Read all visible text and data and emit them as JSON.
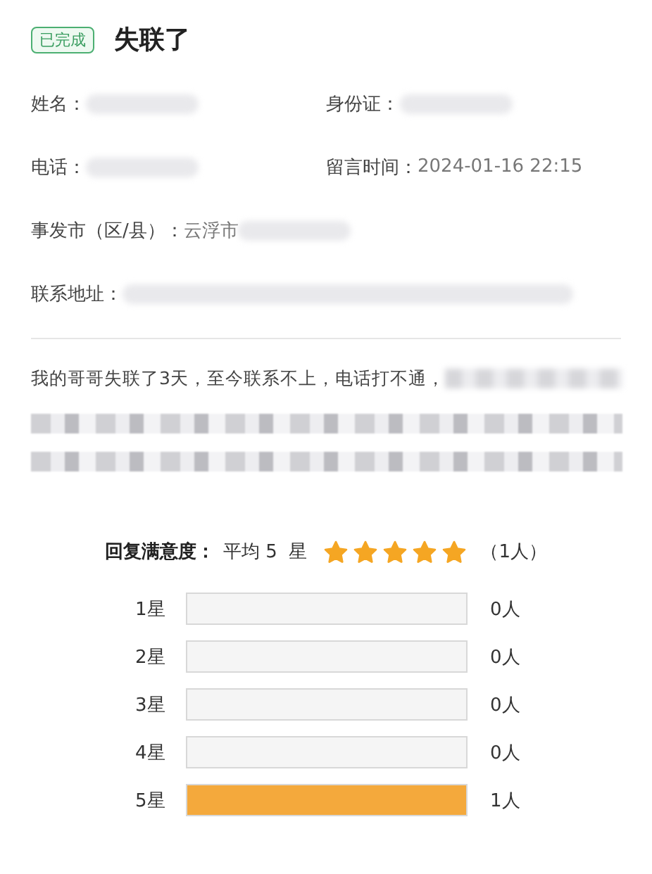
{
  "status_badge": "已完成",
  "title": "失联了",
  "field_rows": [
    [
      {
        "label": "姓名：",
        "redacted": true
      },
      {
        "label": "身份证：",
        "redacted": true
      }
    ],
    [
      {
        "label": "电话：",
        "redacted": true
      },
      {
        "label": "留言时间：",
        "value": "2024-01-16 22:15"
      }
    ],
    [
      {
        "label": "事发市（区/县）：",
        "value": "云浮市",
        "redacted": true
      }
    ],
    [
      {
        "label": "联系地址：",
        "redacted": true
      }
    ]
  ],
  "message": {
    "text": "我的哥哥失联了3天，至今联系不上，电话打不通，"
  },
  "rating": {
    "label": "回复满意度：",
    "average": "平均 5  星",
    "stars": 5,
    "count": "（1人）"
  },
  "distribution": [
    {
      "label": "1星",
      "count": "0人"
    },
    {
      "label": "2星",
      "count": "0人"
    },
    {
      "label": "3星",
      "count": "0人"
    },
    {
      "label": "4星",
      "count": "0人"
    },
    {
      "label": "5星",
      "level": 1,
      "count": "1人"
    }
  ]
}
